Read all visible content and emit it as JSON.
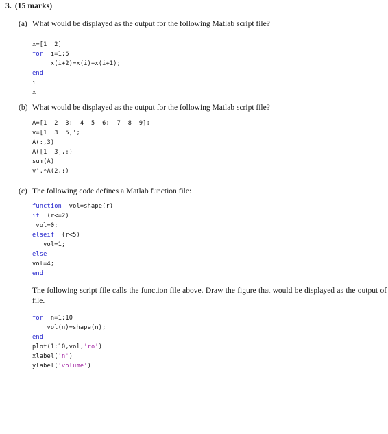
{
  "question": {
    "number": "3.",
    "marks": "(15 marks)"
  },
  "parts": [
    {
      "label": "(a)",
      "prompt": "What would be displayed as the output for the following Matlab script file?",
      "code": [
        [
          {
            "t": "x=[1  2]",
            "c": "plain"
          }
        ],
        [
          {
            "t": "for",
            "c": "kw"
          },
          {
            "t": "  i=1:5",
            "c": "plain"
          }
        ],
        [
          {
            "t": "     x(i+2)=x(i)+x(i+1);",
            "c": "plain"
          }
        ],
        [
          {
            "t": "end",
            "c": "kw"
          }
        ],
        [
          {
            "t": "i",
            "c": "plain"
          }
        ],
        [
          {
            "t": "x",
            "c": "plain"
          }
        ]
      ]
    },
    {
      "label": "(b)",
      "prompt": "What would be displayed as the output for the following Matlab script file?",
      "code": [
        [
          {
            "t": "A=[1  2  3;  4  5  6;  7  8  9];",
            "c": "plain"
          }
        ],
        [
          {
            "t": "v=[1  3  5]';",
            "c": "plain"
          }
        ],
        [
          {
            "t": "A(:,3)",
            "c": "plain"
          }
        ],
        [
          {
            "t": "A([1  3],:)",
            "c": "plain"
          }
        ],
        [
          {
            "t": "sum(A)",
            "c": "plain"
          }
        ],
        [
          {
            "t": "v'.*A(2,:)",
            "c": "plain"
          }
        ]
      ]
    },
    {
      "label": "(c)",
      "prompt": "The following code defines a Matlab function file:",
      "code": [
        [
          {
            "t": "function",
            "c": "kw"
          },
          {
            "t": "  vol=shape(r)",
            "c": "plain"
          }
        ],
        [
          {
            "t": "if",
            "c": "kw"
          },
          {
            "t": "  (r<=2)",
            "c": "plain"
          }
        ],
        [
          {
            "t": " vol=0;",
            "c": "plain"
          }
        ],
        [
          {
            "t": "elseif",
            "c": "kw"
          },
          {
            "t": "  (r<5)",
            "c": "plain"
          }
        ],
        [
          {
            "t": "   vol=1;",
            "c": "plain"
          }
        ],
        [
          {
            "t": "else",
            "c": "kw"
          }
        ],
        [
          {
            "t": "vol=4;",
            "c": "plain"
          }
        ],
        [
          {
            "t": "end",
            "c": "kw"
          }
        ]
      ],
      "paragraph": "The following script file calls the function file above.  Draw the figure that would be displayed as the output of this script file.",
      "code2": [
        [
          {
            "t": "for",
            "c": "kw"
          },
          {
            "t": "  n=1:10",
            "c": "plain"
          }
        ],
        [
          {
            "t": "    vol(n)=shape(n);",
            "c": "plain"
          }
        ],
        [
          {
            "t": "end",
            "c": "kw"
          }
        ],
        [
          {
            "t": "plot(1:10,vol,",
            "c": "plain"
          },
          {
            "t": "'ro'",
            "c": "str"
          },
          {
            "t": ")",
            "c": "plain"
          }
        ],
        [
          {
            "t": "xlabel(",
            "c": "plain"
          },
          {
            "t": "'n'",
            "c": "str"
          },
          {
            "t": ")",
            "c": "plain"
          }
        ],
        [
          {
            "t": "ylabel(",
            "c": "plain"
          },
          {
            "t": "'volume'",
            "c": "str"
          },
          {
            "t": ")",
            "c": "plain"
          }
        ]
      ]
    }
  ],
  "colors": {
    "keyword": "#2222cc",
    "string": "#a020a0",
    "text": "#1a1a1a",
    "background": "#ffffff"
  }
}
